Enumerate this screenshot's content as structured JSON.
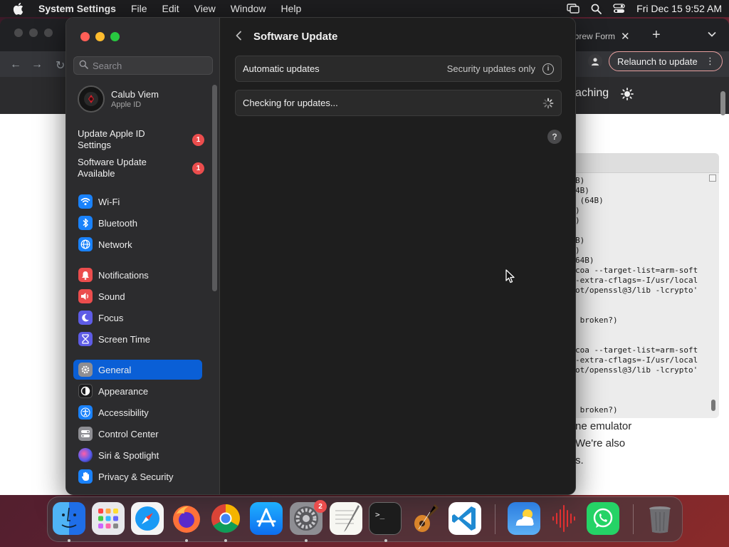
{
  "menubar": {
    "app_name": "System Settings",
    "items": [
      "File",
      "Edit",
      "View",
      "Window",
      "Help"
    ],
    "datetime": "Fri Dec 15  9:52 AM"
  },
  "browser": {
    "tab_title": "ebrew Form",
    "relaunch_label": "Relaunch to update",
    "site_nav_text": "aching",
    "page_lines": [
      "ne emulator",
      "We're also",
      "s."
    ]
  },
  "terminal": {
    "lines": [
      "B)",
      "4B)",
      " (64B)",
      ")",
      ")",
      "",
      "B)",
      ")",
      "64B)",
      "coa --target-list=arm-soft",
      "-extra-cflags=-I/usr/local",
      "ot/openssl@3/lib -lcrypto'",
      "",
      "",
      " broken?)",
      "",
      "",
      "coa --target-list=arm-soft",
      "-extra-cflags=-I/usr/local",
      "ot/openssl@3/lib -lcrypto'",
      "",
      "",
      "",
      " broken?)"
    ]
  },
  "settings": {
    "search_placeholder": "Search",
    "account": {
      "name": "Calub Viem",
      "subtitle": "Apple ID"
    },
    "notices": [
      {
        "label": "Update Apple ID Settings",
        "badge": "1"
      },
      {
        "label": "Software Update Available",
        "badge": "1"
      }
    ],
    "nav_groups": [
      [
        {
          "label": "Wi-Fi",
          "icon": "wifi-icon",
          "color": "#1a82fb"
        },
        {
          "label": "Bluetooth",
          "icon": "bluetooth-icon",
          "color": "#1a82fb"
        },
        {
          "label": "Network",
          "icon": "globe-icon",
          "color": "#1a82fb"
        }
      ],
      [
        {
          "label": "Notifications",
          "icon": "bell-icon",
          "color": "#eb4d4d"
        },
        {
          "label": "Sound",
          "icon": "speaker-icon",
          "color": "#eb4d4d"
        },
        {
          "label": "Focus",
          "icon": "moon-icon",
          "color": "#5e5ce6"
        },
        {
          "label": "Screen Time",
          "icon": "hourglass-icon",
          "color": "#5e5ce6"
        }
      ],
      [
        {
          "label": "General",
          "icon": "gear-icon",
          "color": "#8e8e93",
          "selected": true
        },
        {
          "label": "Appearance",
          "icon": "appearance-icon",
          "color": "#1c1c1e"
        },
        {
          "label": "Accessibility",
          "icon": "accessibility-icon",
          "color": "#1a82fb"
        },
        {
          "label": "Control Center",
          "icon": "control-center-icon",
          "color": "#8e8e93"
        },
        {
          "label": "Siri & Spotlight",
          "icon": "siri-icon",
          "color": "#7a3cc8"
        },
        {
          "label": "Privacy & Security",
          "icon": "hand-icon",
          "color": "#1a82fb"
        }
      ]
    ],
    "page_title": "Software Update",
    "automatic_updates": {
      "label": "Automatic updates",
      "value": "Security updates only"
    },
    "checking_label": "Checking for updates...",
    "help_label": "?"
  },
  "dock": {
    "settings_badge": "2",
    "apps": [
      "finder-icon",
      "launchpad-icon",
      "safari-icon",
      "firefox-icon",
      "chrome-icon",
      "app-store-icon",
      "system-settings-icon",
      "textedit-icon",
      "terminal-icon",
      "garageband-icon",
      "vscode-icon",
      "weather-icon",
      "voice-memos-icon",
      "whatsapp-icon",
      "trash-icon"
    ]
  }
}
